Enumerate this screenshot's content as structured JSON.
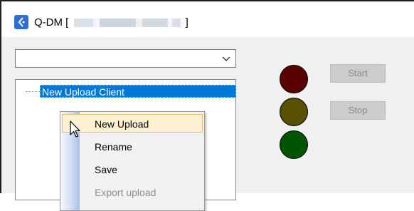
{
  "window": {
    "title_prefix": "Q-DM [",
    "title_suffix": "]",
    "icon": "app-logo-icon"
  },
  "combo": {
    "value": "",
    "icon": "chevron-down-icon"
  },
  "tree": {
    "root_label": "New Upload Client"
  },
  "lights": [
    "red",
    "yellow",
    "green"
  ],
  "buttons": {
    "start_label": "Start",
    "stop_label": "Stop"
  },
  "context_menu": {
    "items": [
      {
        "label": "New Upload",
        "state": "hover"
      },
      {
        "label": "Rename",
        "state": "normal"
      },
      {
        "label": "Save",
        "state": "normal"
      },
      {
        "label": "Export upload",
        "state": "disabled"
      }
    ]
  },
  "colors": {
    "selection": "#0078d7",
    "light_red": "#5a0000",
    "light_yellow": "#565000",
    "light_green": "#005500"
  }
}
